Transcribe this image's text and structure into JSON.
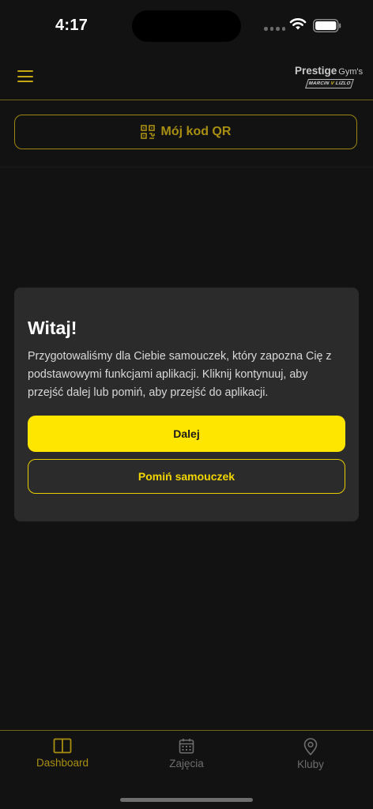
{
  "status_bar": {
    "time": "4:17"
  },
  "header": {
    "logo": {
      "brand": "Prestige",
      "suffix": "Gym's",
      "sub_left": "MARCIN ",
      "sub_accent": "V",
      "sub_right": " LIZLO"
    }
  },
  "qr_button": {
    "label": "Mój kod QR"
  },
  "dialog": {
    "title": "Witaj!",
    "body": "Przygotowaliśmy dla Ciebie samouczek, który zapozna Cię z podstawowymi funkcjami aplikacji. Kliknij kontynuuj, aby przejść dalej lub pomiń, aby przejść do aplikacji.",
    "next_label": "Dalej",
    "skip_label": "Pomiń samouczek"
  },
  "tabbar": {
    "items": [
      {
        "label": "Dashboard",
        "icon": "book-open-icon",
        "active": true
      },
      {
        "label": "Zajęcia",
        "icon": "calendar-icon",
        "active": false
      },
      {
        "label": "Kluby",
        "icon": "map-pin-icon",
        "active": false
      }
    ]
  },
  "colors": {
    "background": "#121212",
    "accent": "#ffe600",
    "accent_muted": "#a88f12",
    "dialog": "#2b2b2b",
    "inactive_tab": "#6e6e6e"
  }
}
